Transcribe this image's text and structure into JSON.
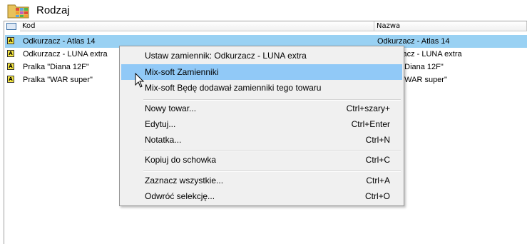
{
  "window": {
    "title": "Rodzaj",
    "icon": "folder-grid-icon"
  },
  "columns": {
    "kod": "Kod",
    "nazwa": "Nazwa"
  },
  "rows": [
    {
      "badge": "A",
      "kod": "Odkurzacz - Atlas 14",
      "nazwa": "Odkurzacz - Atlas 14",
      "selected": true
    },
    {
      "badge": "A",
      "kod": "Odkurzacz - LUNA extra",
      "nazwa": "Odkurzacz - LUNA extra"
    },
    {
      "badge": "A",
      "kod": "Pralka \"Diana 12F\"",
      "nazwa": "Pralka \"Diana 12F\""
    },
    {
      "badge": "A",
      "kod": "Pralka \"WAR super\"",
      "nazwa": "Pralka \"WAR super\""
    }
  ],
  "context_menu": {
    "items": [
      {
        "label": "Ustaw zamiennik: Odkurzacz - LUNA extra",
        "shortcut": ""
      },
      {
        "label": "Mix-soft Zamienniki",
        "shortcut": "",
        "hover": true
      },
      {
        "label": "Mix-soft Będę dodawał zamienniki tego towaru",
        "shortcut": ""
      },
      {
        "label": "Nowy towar...",
        "shortcut": "Ctrl+szary+"
      },
      {
        "label": "Edytuj...",
        "shortcut": "Ctrl+Enter"
      },
      {
        "label": "Notatka...",
        "shortcut": "Ctrl+N"
      },
      {
        "label": "Kopiuj do schowka",
        "shortcut": "Ctrl+C"
      },
      {
        "label": "Zaznacz wszystkie...",
        "shortcut": "Ctrl+A"
      },
      {
        "label": "Odwróć selekcję...",
        "shortcut": "Ctrl+O"
      }
    ]
  },
  "colors": {
    "selection": "#99d1f3",
    "menu_hover": "#91c9f7",
    "menu_bg": "#f0f0f0"
  }
}
